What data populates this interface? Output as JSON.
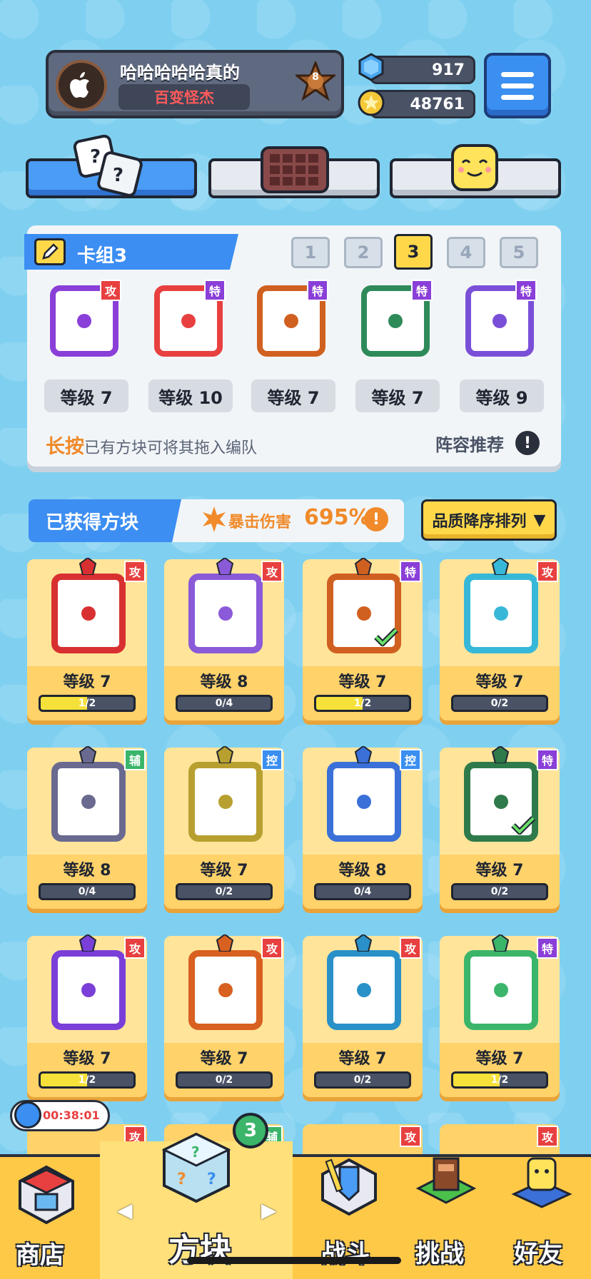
{
  "profile": {
    "name": "哈哈哈哈哈真的",
    "title": "百变怪杰",
    "rank": "8"
  },
  "currency": {
    "gems": "917",
    "coins": "48761"
  },
  "deck": {
    "title": "卡组3",
    "numbers": [
      "1",
      "2",
      "3",
      "4",
      "5"
    ],
    "active_number": "3",
    "cards": [
      {
        "tag": "攻",
        "level": "等级 7",
        "color": "#8a3fd8"
      },
      {
        "tag": "特",
        "level": "等级 10",
        "color": "#e84040"
      },
      {
        "tag": "特",
        "level": "等级 7",
        "color": "#d06020"
      },
      {
        "tag": "特",
        "level": "等级 7",
        "color": "#2f8a5a"
      },
      {
        "tag": "特",
        "level": "等级 9",
        "color": "#7a4fd8"
      }
    ],
    "hint_bold": "长按",
    "hint_text": "已有方块可将其拖入编队",
    "recommend": "阵容推荐"
  },
  "obtained": {
    "label": "已获得方块",
    "crit_label": "暴击伤害",
    "crit_value": "695%",
    "sort_label": "品质降序排列"
  },
  "grid": [
    {
      "tag": "攻",
      "level": "等级 7",
      "progress": "1/2",
      "fill": 0.5,
      "color": "#d83030"
    },
    {
      "tag": "攻",
      "level": "等级 8",
      "progress": "0/4",
      "fill": 0,
      "color": "#8a5ad8"
    },
    {
      "tag": "特",
      "level": "等级 7",
      "progress": "1/2",
      "fill": 0.5,
      "color": "#d06020"
    },
    {
      "tag": "攻",
      "level": "等级 7",
      "progress": "0/2",
      "fill": 0,
      "color": "#38b8d8"
    },
    {
      "tag": "辅",
      "level": "等级 8",
      "progress": "0/4",
      "fill": 0,
      "color": "#6a6a90"
    },
    {
      "tag": "控",
      "level": "等级 7",
      "progress": "0/2",
      "fill": 0,
      "color": "#b8a030"
    },
    {
      "tag": "控",
      "level": "等级 8",
      "progress": "0/4",
      "fill": 0,
      "color": "#3a70d8"
    },
    {
      "tag": "特",
      "level": "等级 7",
      "progress": "0/2",
      "fill": 0,
      "color": "#2f7a4a"
    },
    {
      "tag": "攻",
      "level": "等级 7",
      "progress": "1/2",
      "fill": 0.5,
      "color": "#7a3fd8"
    },
    {
      "tag": "攻",
      "level": "等级 7",
      "progress": "0/2",
      "fill": 0,
      "color": "#d86020"
    },
    {
      "tag": "攻",
      "level": "等级 7",
      "progress": "0/2",
      "fill": 0,
      "color": "#2a90c8"
    },
    {
      "tag": "特",
      "level": "等级 7",
      "progress": "1/2",
      "fill": 0.5,
      "color": "#3bb56a"
    }
  ],
  "partial_row": [
    {
      "tag": "攻"
    },
    {
      "tag": "辅"
    },
    {
      "tag": "攻"
    },
    {
      "tag": "攻"
    }
  ],
  "timer": "00:38:01",
  "nav": {
    "shop": "商店",
    "blocks": "方块",
    "battle": "战斗",
    "challenge": "挑战",
    "friends": "好友",
    "blocks_badge": "3"
  }
}
